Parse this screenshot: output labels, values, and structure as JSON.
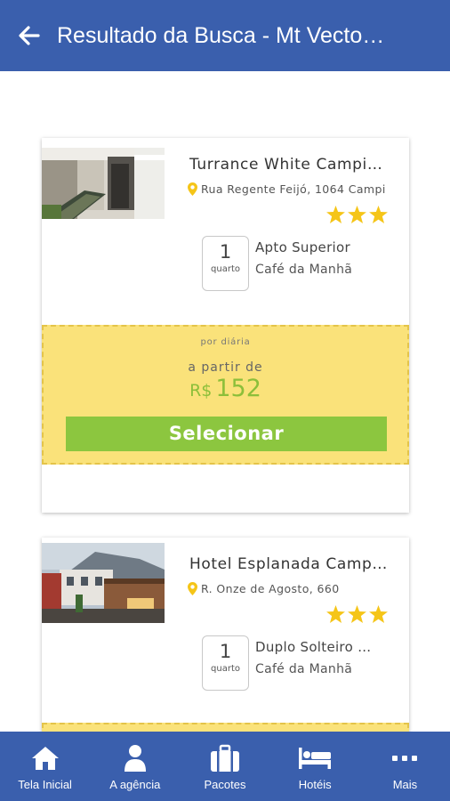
{
  "header": {
    "title": "Resultado da Busca - Mt Vecto…",
    "back_icon": "arrow-left-icon"
  },
  "hotels": [
    {
      "name": "Turrance White Campi…",
      "address": "Rua Regente Feijó, 1064 Campi",
      "stars": 3,
      "rooms": "1",
      "rooms_label": "quarto",
      "room_type": "Apto Superior",
      "meal": "Café da Manhã",
      "per_night": "por diária",
      "from_label": "a partir de",
      "currency": "R$",
      "price": "152",
      "select_label": "Selecionar"
    },
    {
      "name": "Hotel Esplanada Camp…",
      "address": "R. Onze de Agosto, 660",
      "stars": 3,
      "rooms": "1",
      "rooms_label": "quarto",
      "room_type": "Duplo Solteiro …",
      "meal": "Café da Manhã"
    }
  ],
  "nav": [
    {
      "label": "Tela Inicial",
      "icon": "home-icon"
    },
    {
      "label": "A agência",
      "icon": "user-icon"
    },
    {
      "label": "Pacotes",
      "icon": "briefcase-icon"
    },
    {
      "label": "Hotéis",
      "icon": "bed-icon"
    },
    {
      "label": "Mais",
      "icon": "more-icon"
    }
  ],
  "colors": {
    "primary": "#3a5fad",
    "price_bg": "#fae27a",
    "accent_green": "#8cc63f",
    "star": "#f5c518"
  }
}
